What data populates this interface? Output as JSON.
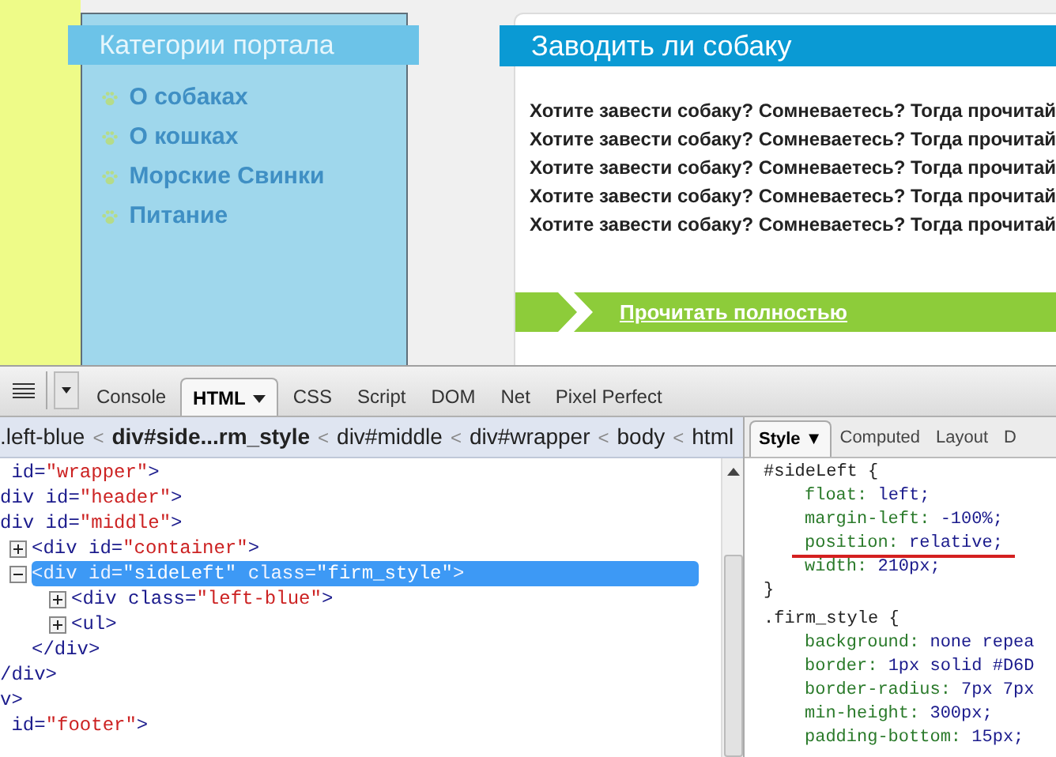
{
  "sidebar": {
    "title": "Категории портала",
    "items": [
      {
        "label": "О собаках"
      },
      {
        "label": "О кошках"
      },
      {
        "label": "Морские Свинки"
      },
      {
        "label": "Питание"
      }
    ]
  },
  "article": {
    "title": "Заводить ли собаку",
    "lines": [
      "Хотите завести собаку? Сомневаетесь? Тогда прочитай",
      "Хотите завести собаку? Сомневаетесь? Тогда прочитай",
      "Хотите завести собаку? Сомневаетесь? Тогда прочитай",
      "Хотите завести собаку? Сомневаетесь? Тогда прочитай",
      "Хотите завести собаку? Сомневаетесь? Тогда прочитай"
    ],
    "read_more": "Прочитать полностью"
  },
  "devtools": {
    "tabs": [
      {
        "label": "Console",
        "selected": false
      },
      {
        "label": "HTML",
        "selected": true
      },
      {
        "label": "CSS",
        "selected": false
      },
      {
        "label": "Script",
        "selected": false
      },
      {
        "label": "DOM",
        "selected": false
      },
      {
        "label": "Net",
        "selected": false
      },
      {
        "label": "Pixel Perfect",
        "selected": false
      }
    ],
    "breadcrumbs": [
      {
        "label": ".left-blue",
        "selected": false
      },
      {
        "label": "div#side...rm_style",
        "selected": true
      },
      {
        "label": "div#middle",
        "selected": false
      },
      {
        "label": "div#wrapper",
        "selected": false
      },
      {
        "label": "body",
        "selected": false
      },
      {
        "label": "html",
        "selected": false
      }
    ],
    "breadcrumb_separator": "<",
    "html_tree": [
      {
        "parts": [
          {
            "kind": "tag",
            "text": " id="
          },
          {
            "kind": "value",
            "text": "\"wrapper\""
          },
          {
            "kind": "tag",
            "text": ">"
          }
        ],
        "close": "v>",
        "children": [
          {
            "parts": [
              {
                "kind": "tag",
                "text": "div id="
              },
              {
                "kind": "value",
                "text": "\"header\""
              },
              {
                "kind": "tag",
                "text": ">"
              }
            ]
          },
          {
            "parts": [
              {
                "kind": "tag",
                "text": "div id="
              },
              {
                "kind": "value",
                "text": "\"middle\""
              },
              {
                "kind": "tag",
                "text": ">"
              }
            ],
            "close": "/div>",
            "children": [
              {
                "expanded": false,
                "selected": false,
                "parts": [
                  {
                    "kind": "tag",
                    "text": "<div id="
                  },
                  {
                    "kind": "value",
                    "text": "\"container\""
                  },
                  {
                    "kind": "tag",
                    "text": ">"
                  }
                ]
              },
              {
                "expanded": true,
                "selected": true,
                "parts": [
                  {
                    "kind": "tag",
                    "text": "<div id="
                  },
                  {
                    "kind": "value",
                    "text": "\"sideLeft\""
                  },
                  {
                    "kind": "tag",
                    "text": " class="
                  },
                  {
                    "kind": "value",
                    "text": "\"firm_style\""
                  },
                  {
                    "kind": "tag",
                    "text": ">"
                  }
                ],
                "close": "</div>",
                "children": [
                  {
                    "expanded": false,
                    "selected": false,
                    "parts": [
                      {
                        "kind": "tag",
                        "text": "<div class="
                      },
                      {
                        "kind": "value",
                        "text": "\"left-blue\""
                      },
                      {
                        "kind": "tag",
                        "text": ">"
                      }
                    ]
                  },
                  {
                    "expanded": false,
                    "selected": false,
                    "parts": [
                      {
                        "kind": "tag",
                        "text": "<ul>"
                      }
                    ]
                  }
                ]
              }
            ]
          }
        ]
      },
      {
        "parts": [
          {
            "kind": "tag",
            "text": " id="
          },
          {
            "kind": "value",
            "text": "\"footer\""
          },
          {
            "kind": "tag",
            "text": ">"
          }
        ]
      }
    ],
    "side_tabs": [
      {
        "label": "Style ▼",
        "selected": true
      },
      {
        "label": "Computed",
        "selected": false
      },
      {
        "label": "Layout",
        "selected": false
      },
      {
        "label": "D",
        "selected": false
      }
    ],
    "css_rules": [
      {
        "selector": "#sideLeft {",
        "declarations": [
          {
            "property": "float:",
            "value": "left;",
            "underlined": false
          },
          {
            "property": "margin-left:",
            "value": "-100%;",
            "underlined": false
          },
          {
            "property": "position:",
            "value": "relative;",
            "underlined": true
          },
          {
            "property": "width:",
            "value": "210px;",
            "underlined": false
          }
        ],
        "close": "}"
      },
      {
        "selector": ".firm_style {",
        "declarations": [
          {
            "property": "background:",
            "value": "none repea",
            "underlined": false
          },
          {
            "property": "border:",
            "value": "1px solid #D6D",
            "underlined": false
          },
          {
            "property": "border-radius:",
            "value": "7px 7px",
            "underlined": false
          },
          {
            "property": "min-height:",
            "value": "300px;",
            "underlined": false
          },
          {
            "property": "padding-bottom:",
            "value": "15px;",
            "underlined": false
          }
        ]
      }
    ]
  }
}
